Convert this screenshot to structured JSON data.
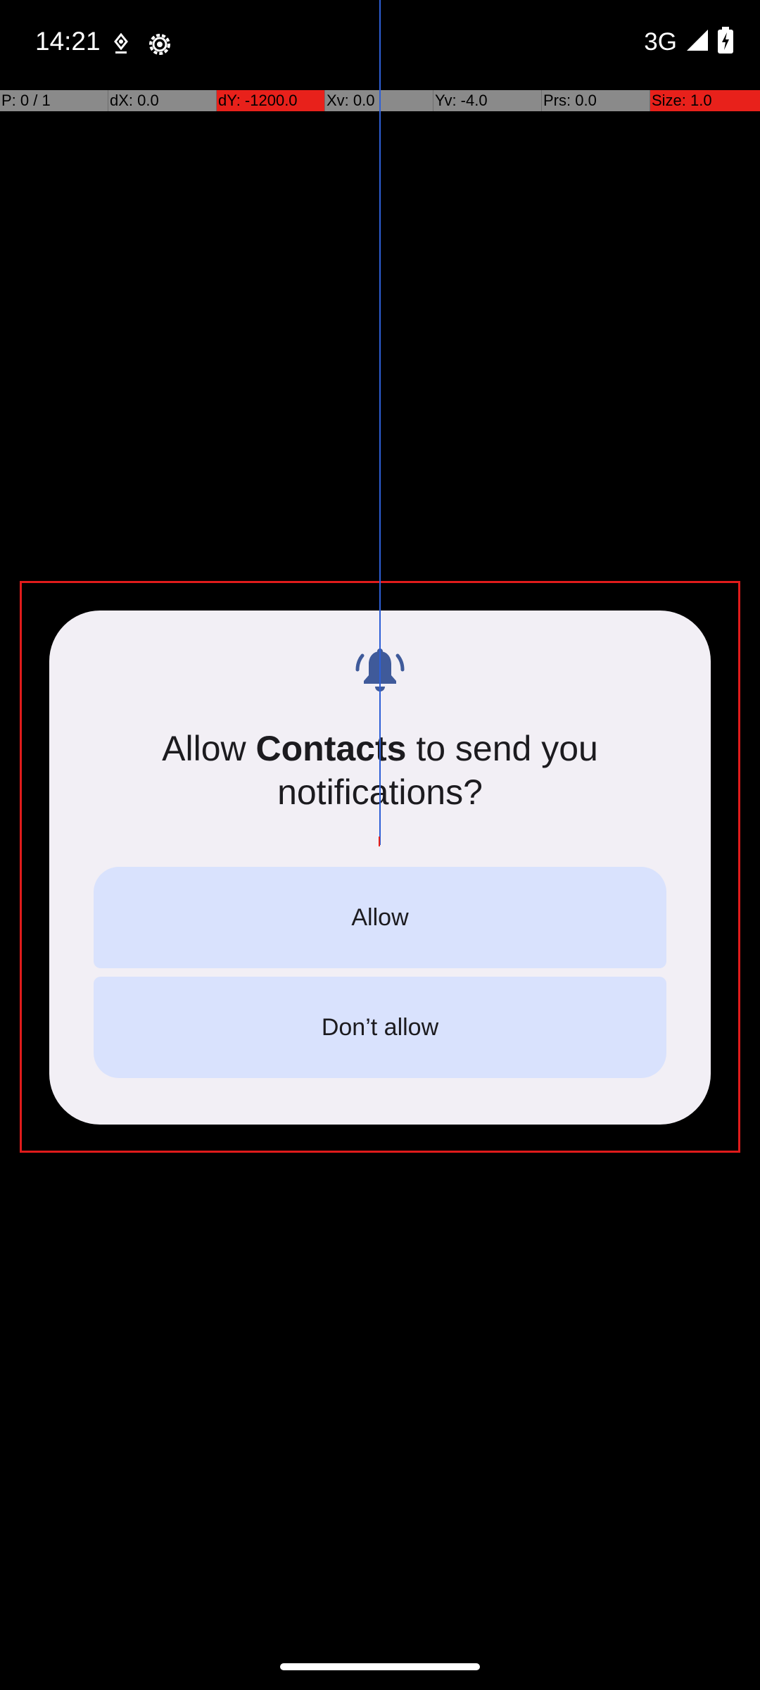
{
  "status_bar": {
    "time": "14:21",
    "network": "3G",
    "icons": [
      "location-pin-icon",
      "settings-gear-icon",
      "signal-icon",
      "battery-charging-icon"
    ]
  },
  "pointer_bar": {
    "cells": [
      {
        "text": "P: 0 / 1",
        "alert": false
      },
      {
        "text": "dX: 0.0",
        "alert": false
      },
      {
        "text": "dY: -1200.0",
        "alert": true
      },
      {
        "text": "Xv: 0.0",
        "alert": false
      },
      {
        "text": "Yv: -4.0",
        "alert": false
      },
      {
        "text": "Prs: 0.0",
        "alert": false
      },
      {
        "text": "Size: 1.0",
        "alert": true
      }
    ]
  },
  "dialog": {
    "icon": "notification-bell-icon",
    "title_prefix": "Allow ",
    "title_app": "Contacts",
    "title_suffix": " to send you notifications?",
    "allow_label": "Allow",
    "deny_label": "Don’t allow"
  },
  "colors": {
    "background": "#000000",
    "dialog_bg": "#f2eff5",
    "button_bg": "#d9e2fd",
    "icon_color": "#3f5a9a",
    "alert_red": "#e8211b",
    "trace_blue": "#2e5fd6"
  }
}
